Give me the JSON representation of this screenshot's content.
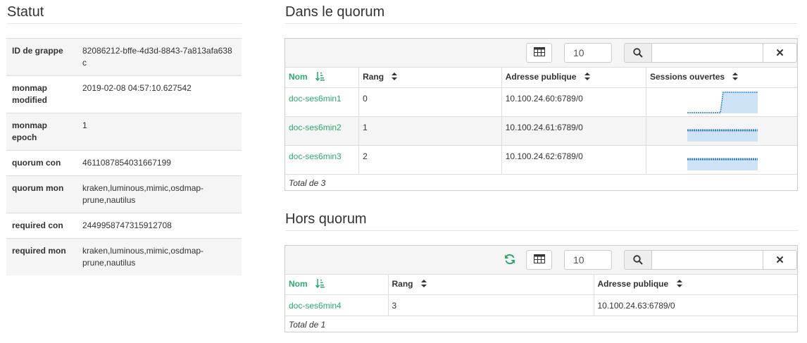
{
  "statut": {
    "title": "Statut",
    "rows": [
      {
        "key": "ID de grappe",
        "value": "82086212-bffe-4d3d-8843-7a813afa638c"
      },
      {
        "key": "monmap modified",
        "value": "2019-02-08 04:57:10.627542"
      },
      {
        "key": "monmap epoch",
        "value": "1"
      },
      {
        "key": "quorum con",
        "value": "4611087854031667199"
      },
      {
        "key": "quorum mon",
        "value": "kraken,luminous,mimic,osdmap-prune,nautilus"
      },
      {
        "key": "required con",
        "value": "2449958747315912708"
      },
      {
        "key": "required mon",
        "value": "kraken,luminous,mimic,osdmap-prune,nautilus"
      }
    ]
  },
  "in_quorum": {
    "title": "Dans le quorum",
    "page_size": "10",
    "columns": [
      "Nom",
      "Rang",
      "Adresse publique",
      "Sessions ouvertes"
    ],
    "rows": [
      {
        "name": "doc-ses6min1",
        "rank": "0",
        "address": "10.100.24.60:6789/0"
      },
      {
        "name": "doc-ses6min2",
        "rank": "1",
        "address": "10.100.24.61:6789/0"
      },
      {
        "name": "doc-ses6min3",
        "rank": "2",
        "address": "10.100.24.62:6789/0"
      }
    ],
    "footer": "Total de 3"
  },
  "out_quorum": {
    "title": "Hors quorum",
    "page_size": "10",
    "columns": [
      "Nom",
      "Rang",
      "Adresse publique"
    ],
    "rows": [
      {
        "name": "doc-ses6min4",
        "rank": "3",
        "address": "10.100.24.63:6789/0"
      }
    ],
    "footer": "Total de 1"
  },
  "colors": {
    "accent": "#2baa6d",
    "sparkline_line": "#2f7ed8",
    "sparkline_fill": "#cfe3f7"
  },
  "icons": {
    "table": "table-icon",
    "search": "search-icon",
    "clear": "close-icon",
    "sort": "sort-icon",
    "sort_active": "sort-amount-asc-icon",
    "refresh": "refresh-icon"
  }
}
